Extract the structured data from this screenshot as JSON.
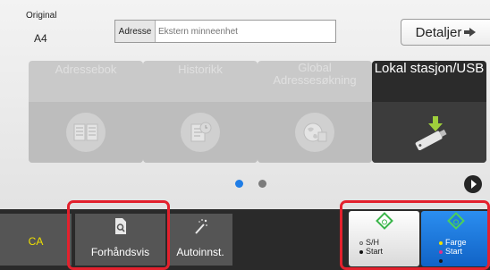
{
  "original": {
    "label": "Original",
    "value": "A4"
  },
  "address": {
    "label": "Adresse",
    "placeholder": "Ekstern minneenhet"
  },
  "details_button": {
    "label": "Detaljer"
  },
  "tiles": [
    {
      "label": "Adressebok",
      "icon": "address-book-icon"
    },
    {
      "label": "Historikk",
      "icon": "history-icon"
    },
    {
      "label": "Global Adressesøkning",
      "icon": "globe-icon"
    },
    {
      "label": "Lokal stasjon/USB",
      "icon": "usb-drive-icon"
    }
  ],
  "pagination": {
    "current": 1,
    "total": 2
  },
  "bottom_bar": {
    "ca_label": "CA",
    "preview_label": "Forhåndsvis",
    "auto_label": "Autoinnst.",
    "bw_start": {
      "line1": "S/H",
      "line2": "Start"
    },
    "color_start": {
      "line1": "Farge",
      "line2": "Start"
    }
  },
  "colors": {
    "accent_blue": "#1f7de6",
    "highlight_red": "#e3212d",
    "start_green": "#3ab54a",
    "ca_yellow": "#f0e000"
  }
}
